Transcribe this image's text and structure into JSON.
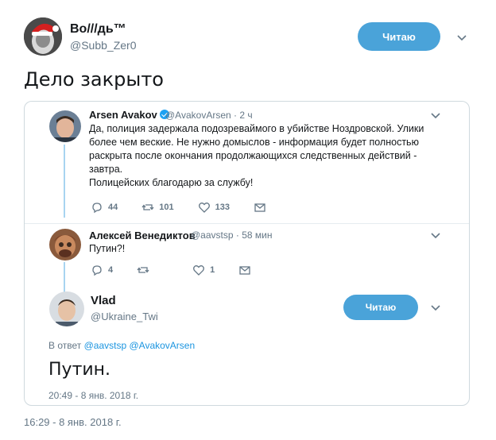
{
  "outer": {
    "name": "Во///дь™",
    "handle": "@Subb_Zer0",
    "follow_label": "Читаю",
    "text": "Дело закрыто",
    "timestamp": "16:29 - 8 янв. 2018 г."
  },
  "thread": [
    {
      "name": "Arsen Avakov",
      "verified": true,
      "handle_time": "@AvakovArsen · 2 ч",
      "lines": [
        "Да, полиция задержала подозреваймого в убийстве Ноздровской. Улики",
        "более чем веские. Не нужно домыслов - информация будет полностью",
        "раскрыта после окончания продолжающихся  следственных действий -",
        "завтра.",
        "Полицейских благодарю за службу!"
      ],
      "replies": "44",
      "retweets": "101",
      "likes": "133"
    },
    {
      "name": "Алексей Венедиктов",
      "handle_time": "@aavstsp · 58 мин",
      "lines": [
        "Путин?!"
      ],
      "replies": "4",
      "retweets": "",
      "likes": "1"
    }
  ],
  "focus": {
    "name": "Vlad",
    "handle": "@Ukraine_Twi",
    "follow_label": "Читаю",
    "reply_prefix": "В ответ",
    "reply_users": "@aavstsp @AvakovArsen",
    "text": "Путин.",
    "timestamp": "20:49 - 8 янв. 2018 г."
  },
  "colors": {
    "accent": "#4aa3d9",
    "link": "#1b95e0",
    "secondary_text": "#657786",
    "thread_line": "#a8d4f0"
  }
}
